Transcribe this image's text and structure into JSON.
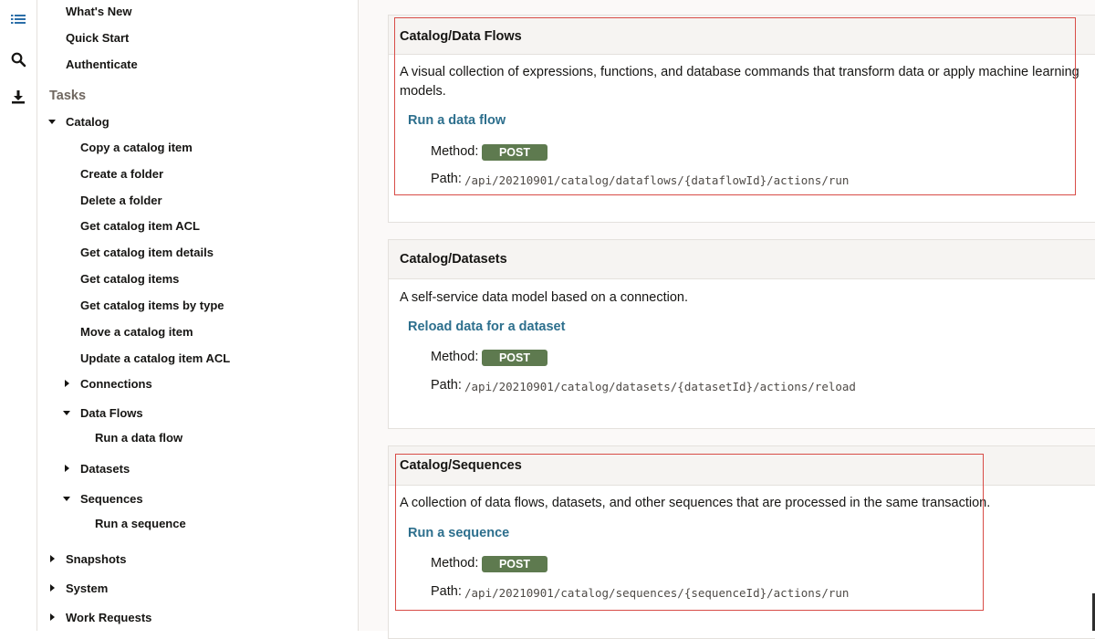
{
  "rail": {
    "icons": [
      "list-icon",
      "search-icon",
      "download-icon"
    ]
  },
  "nav": {
    "top_items": [
      "What's New",
      "Quick Start",
      "Authenticate"
    ],
    "tasks_label": "Tasks",
    "catalog": "Catalog",
    "catalog_items": [
      "Copy a catalog item",
      "Create a folder",
      "Delete a folder",
      "Get catalog item ACL",
      "Get catalog item details",
      "Get catalog items",
      "Get catalog items by type",
      "Move a catalog item",
      "Update a catalog item ACL"
    ],
    "connections": "Connections",
    "data_flows": "Data Flows",
    "run_data_flow": "Run a data flow",
    "datasets": "Datasets",
    "sequences": "Sequences",
    "run_sequence": "Run a sequence",
    "snapshots": "Snapshots",
    "system": "System",
    "work_requests": "Work Requests"
  },
  "sections": [
    {
      "title": "Catalog/Data Flows",
      "description": "A visual collection of expressions, functions, and database commands that transform data or apply machine learning models.",
      "operation": "Run a data flow",
      "method_label": "Method:",
      "method": "POST",
      "path_label": "Path:",
      "path": "/api/20210901/catalog/dataflows/{dataflowId}/actions/run"
    },
    {
      "title": "Catalog/Datasets",
      "description": "A self-service data model based on a connection.",
      "operation": "Reload data for a dataset",
      "method_label": "Method:",
      "method": "POST",
      "path_label": "Path:",
      "path": "/api/20210901/catalog/datasets/{datasetId}/actions/reload"
    },
    {
      "title": "Catalog/Sequences",
      "description": "A collection of data flows, datasets, and other sequences that are processed in the same transaction.",
      "operation": "Run a sequence",
      "method_label": "Method:",
      "method": "POST",
      "path_label": "Path:",
      "path": "/api/20210901/catalog/sequences/{sequenceId}/actions/run"
    }
  ],
  "colors": {
    "link": "#2d6f8d",
    "method_badge": "#5e7a4f",
    "highlight": "#d84c47"
  }
}
